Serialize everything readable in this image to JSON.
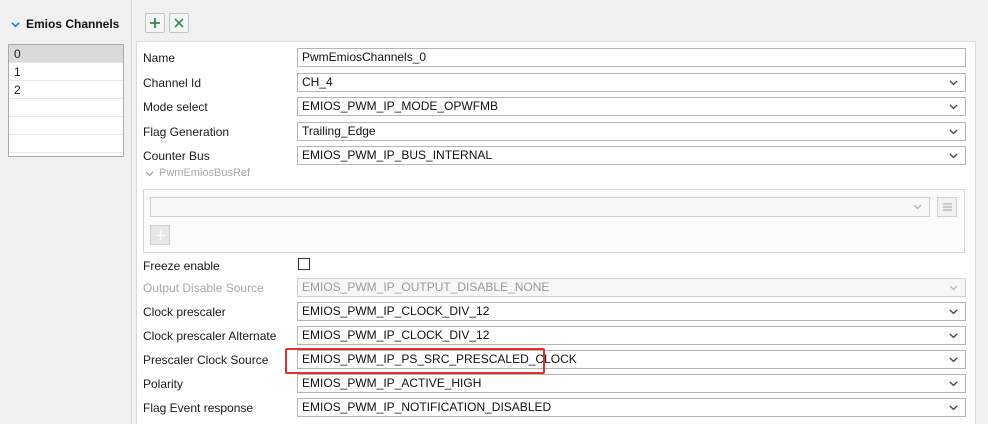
{
  "section": {
    "title": "Emios Channels",
    "icon": "chevron-down-icon"
  },
  "channel_list": [
    {
      "label": "0",
      "selected": true
    },
    {
      "label": "1",
      "selected": false
    },
    {
      "label": "2",
      "selected": false
    },
    {
      "label": "",
      "selected": false
    },
    {
      "label": "",
      "selected": false
    },
    {
      "label": "",
      "selected": false
    }
  ],
  "toolbar": {
    "add_icon": "plus-icon",
    "remove_icon": "close-icon",
    "accent": "#2e8b57"
  },
  "form": {
    "name": {
      "label": "Name",
      "value": "PwmEmiosChannels_0"
    },
    "channel_id": {
      "label": "Channel Id",
      "value": "CH_4"
    },
    "mode_select": {
      "label": "Mode select",
      "value": "EMIOS_PWM_IP_MODE_OPWFMB"
    },
    "flag_generation": {
      "label": "Flag Generation",
      "value": "Trailing_Edge"
    },
    "counter_bus": {
      "label": "Counter Bus",
      "value": "EMIOS_PWM_IP_BUS_INTERNAL"
    },
    "bus_ref": {
      "label": "PwmEmiosBusRef",
      "value": ""
    },
    "freeze_enable": {
      "label": "Freeze enable",
      "checked": false
    },
    "output_disable_source": {
      "label": "Output Disable Source",
      "value": "EMIOS_PWM_IP_OUTPUT_DISABLE_NONE"
    },
    "clock_prescaler": {
      "label": "Clock prescaler",
      "value": "EMIOS_PWM_IP_CLOCK_DIV_12"
    },
    "clock_prescaler_alt": {
      "label": "Clock prescaler Alternate",
      "value": "EMIOS_PWM_IP_CLOCK_DIV_12"
    },
    "prescaler_clock_source": {
      "label": "Prescaler Clock Source",
      "value": "EMIOS_PWM_IP_PS_SRC_PRESCALED_CLOCK"
    },
    "polarity": {
      "label": "Polarity",
      "value": "EMIOS_PWM_IP_ACTIVE_HIGH"
    },
    "flag_event_response": {
      "label": "Flag Event response",
      "value": "EMIOS_PWM_IP_NOTIFICATION_DISABLED"
    }
  },
  "highlight_color": "#e0302a"
}
